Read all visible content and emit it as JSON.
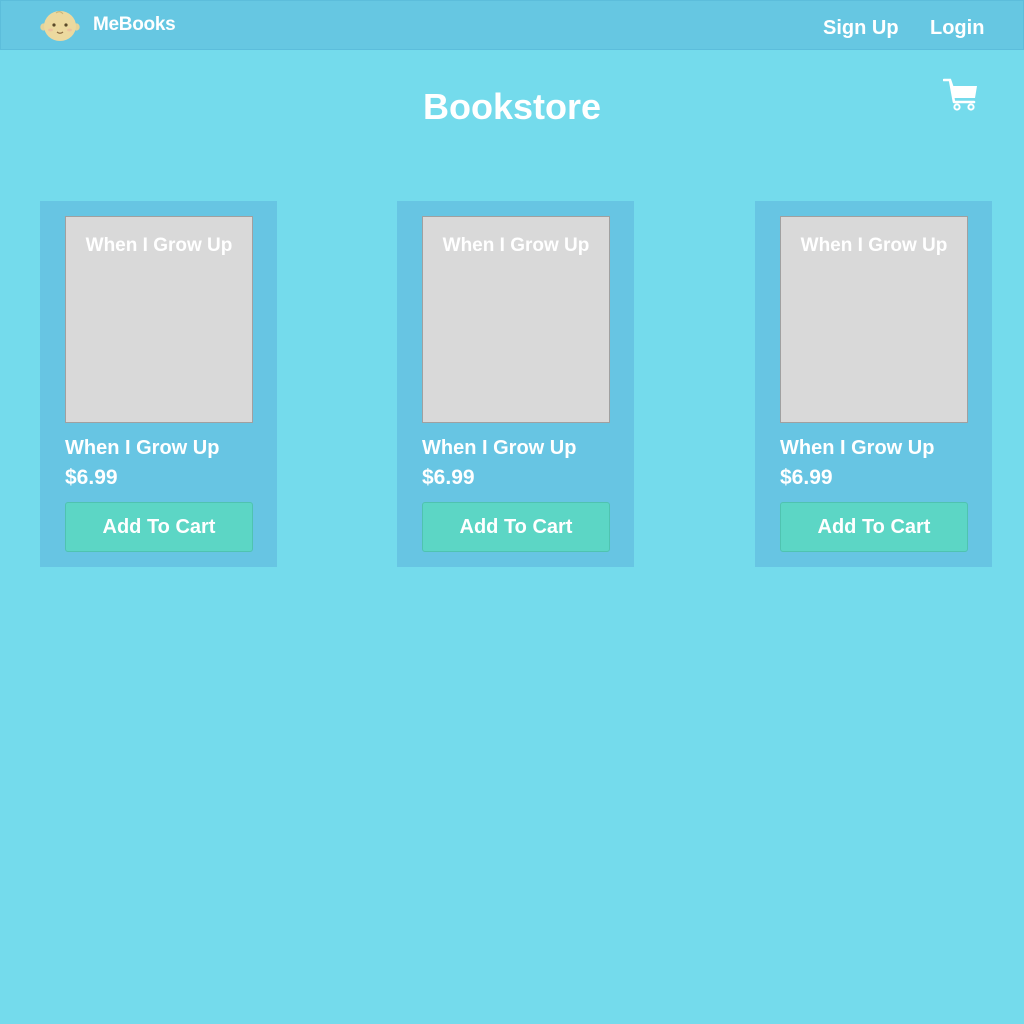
{
  "brand": {
    "name": "MeBooks",
    "logo_icon": "baby-face-icon"
  },
  "nav": {
    "signup_label": "Sign Up",
    "login_label": "Login"
  },
  "page": {
    "title": "Bookstore",
    "cart_icon": "cart-icon"
  },
  "books": [
    {
      "cover_title": "When I Grow Up",
      "title": "When I Grow Up",
      "price": "$6.99",
      "button_label": "Add To Cart"
    },
    {
      "cover_title": "When I Grow Up",
      "title": "When I Grow Up",
      "price": "$6.99",
      "button_label": "Add To Cart"
    },
    {
      "cover_title": "When I Grow Up",
      "title": "When I Grow Up",
      "price": "$6.99",
      "button_label": "Add To Cart"
    }
  ],
  "colors": {
    "background": "#74dbec",
    "topbar": "#66c7e2",
    "card": "#67c5e3",
    "cover": "#d9d9d9",
    "button": "#5cd6c5",
    "text": "#ffffff"
  }
}
